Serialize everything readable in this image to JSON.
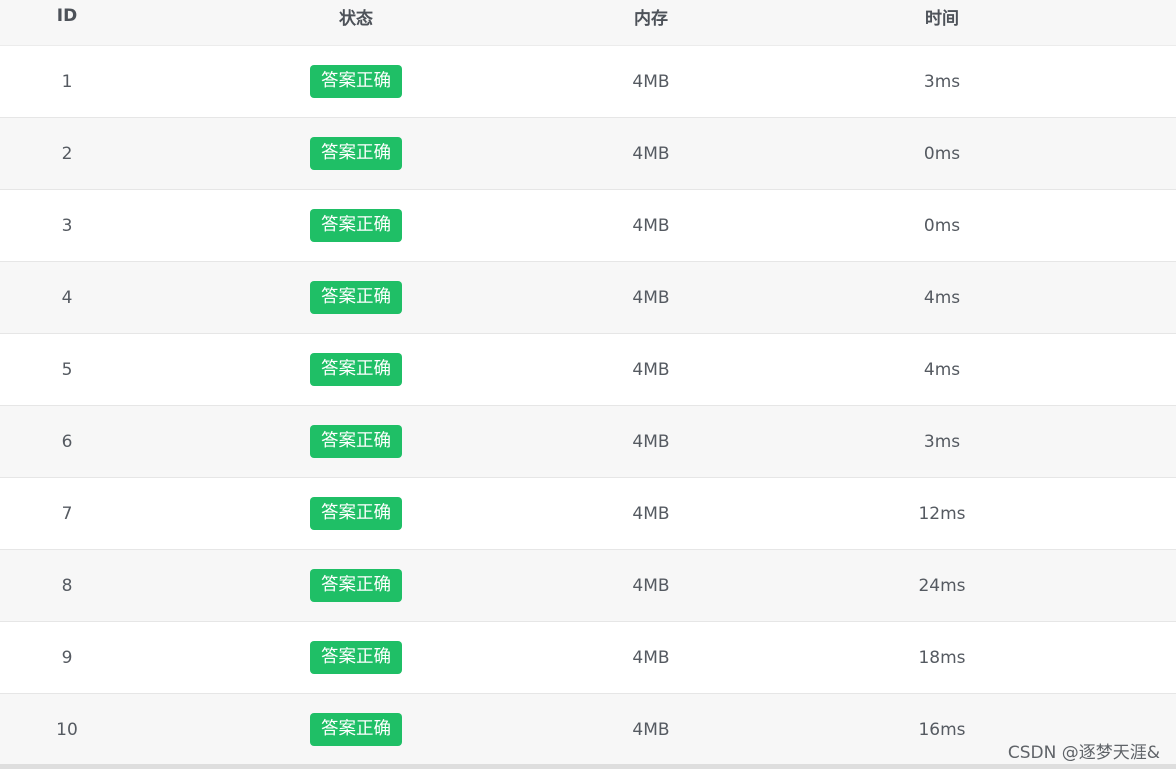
{
  "table": {
    "headers": {
      "id": "ID",
      "status": "状态",
      "memory": "内存",
      "time": "时间"
    },
    "rows": [
      {
        "id": "1",
        "status": "答案正确",
        "memory": "4MB",
        "time": "3ms"
      },
      {
        "id": "2",
        "status": "答案正确",
        "memory": "4MB",
        "time": "0ms"
      },
      {
        "id": "3",
        "status": "答案正确",
        "memory": "4MB",
        "time": "0ms"
      },
      {
        "id": "4",
        "status": "答案正确",
        "memory": "4MB",
        "time": "4ms"
      },
      {
        "id": "5",
        "status": "答案正确",
        "memory": "4MB",
        "time": "4ms"
      },
      {
        "id": "6",
        "status": "答案正确",
        "memory": "4MB",
        "time": "3ms"
      },
      {
        "id": "7",
        "status": "答案正确",
        "memory": "4MB",
        "time": "12ms"
      },
      {
        "id": "8",
        "status": "答案正确",
        "memory": "4MB",
        "time": "24ms"
      },
      {
        "id": "9",
        "status": "答案正确",
        "memory": "4MB",
        "time": "18ms"
      },
      {
        "id": "10",
        "status": "答案正确",
        "memory": "4MB",
        "time": "16ms"
      }
    ]
  },
  "colors": {
    "accepted_badge": "#1fbf66",
    "header_bg": "#f7f7f7",
    "stripe_bg": "#f7f7f7",
    "text": "#555a61"
  },
  "watermark": "CSDN @逐梦天涯&"
}
